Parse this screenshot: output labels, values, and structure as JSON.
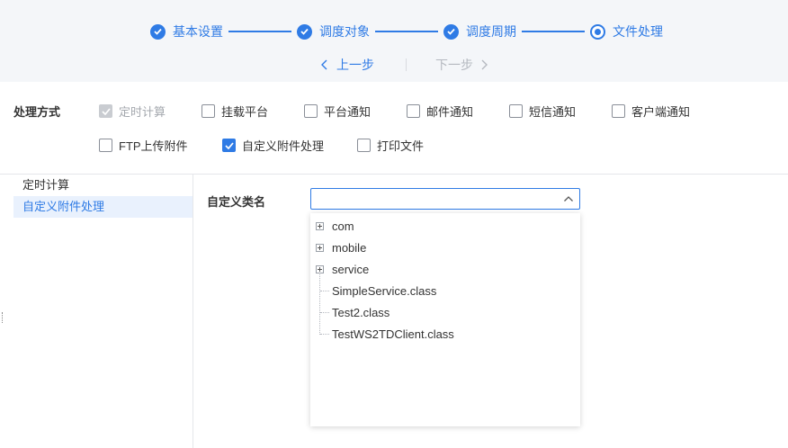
{
  "wizard": {
    "steps": [
      {
        "label": "基本设置",
        "state": "done"
      },
      {
        "label": "调度对象",
        "state": "done"
      },
      {
        "label": "调度周期",
        "state": "done"
      },
      {
        "label": "文件处理",
        "state": "current"
      }
    ],
    "prev_label": "上一步",
    "next_label": "下一步"
  },
  "processing": {
    "label": "处理方式",
    "options": [
      {
        "label": "定时计算",
        "checked": true,
        "disabled": true
      },
      {
        "label": "挂载平台",
        "checked": false
      },
      {
        "label": "平台通知",
        "checked": false
      },
      {
        "label": "邮件通知",
        "checked": false
      },
      {
        "label": "短信通知",
        "checked": false
      },
      {
        "label": "客户端通知",
        "checked": false
      },
      {
        "label": "FTP上传附件",
        "checked": false
      },
      {
        "label": "自定义附件处理",
        "checked": true
      },
      {
        "label": "打印文件",
        "checked": false
      }
    ]
  },
  "side_nav": {
    "items": [
      {
        "label": "定时计算",
        "active": false
      },
      {
        "label": "自定义附件处理",
        "active": true
      }
    ]
  },
  "class_field": {
    "label": "自定义类名",
    "value": ""
  },
  "class_tree": {
    "nodes": [
      {
        "label": "com",
        "type": "folder"
      },
      {
        "label": "mobile",
        "type": "folder"
      },
      {
        "label": "service",
        "type": "folder"
      },
      {
        "label": "SimpleService.class",
        "type": "file"
      },
      {
        "label": "Test2.class",
        "type": "file"
      },
      {
        "label": "TestWS2TDClient.class",
        "type": "file"
      }
    ]
  },
  "colors": {
    "accent": "#2f7be5",
    "header_bg": "#f4f6f9",
    "active_bg": "#e9f1fd"
  }
}
